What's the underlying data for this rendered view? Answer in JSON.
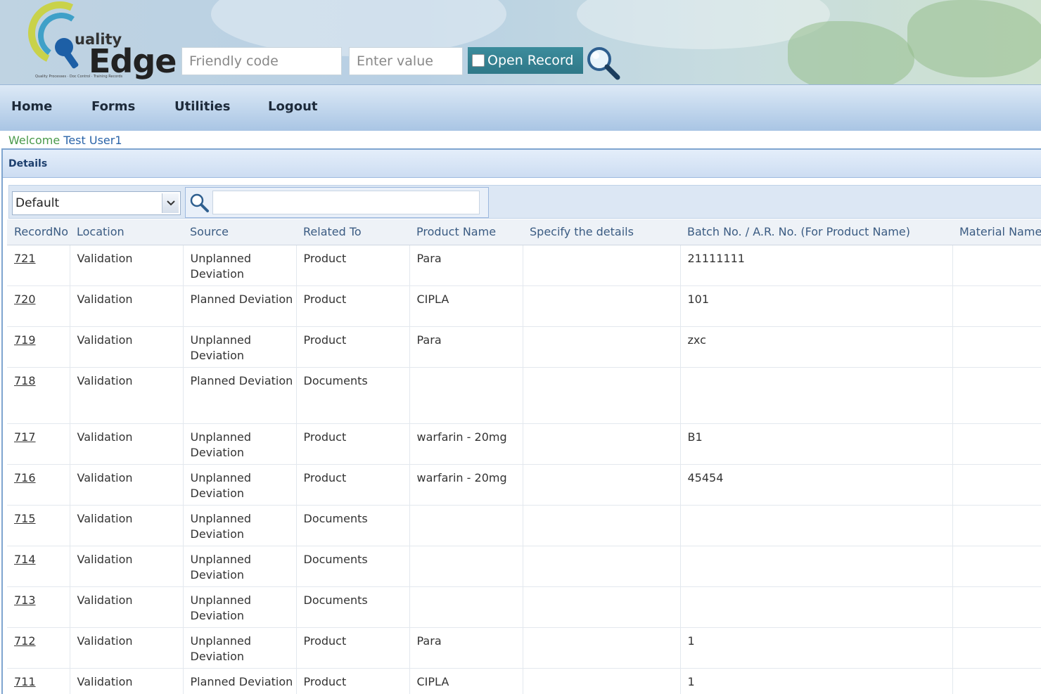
{
  "header": {
    "logo": {
      "prefix": "uality",
      "name": "Edge",
      "tagline": "Quality Processes · Doc Control · Training Records"
    },
    "friendly_code_placeholder": "Friendly code",
    "value_placeholder": "Enter value",
    "open_record_label": "Open Record"
  },
  "nav": {
    "items": [
      {
        "label": "Home"
      },
      {
        "label": "Forms"
      },
      {
        "label": "Utilities"
      },
      {
        "label": "Logout"
      }
    ]
  },
  "welcome": {
    "prefix": "Welcome",
    "user": "Test User1"
  },
  "panel": {
    "title": "Details"
  },
  "toolbar": {
    "view_selected": "Default",
    "search_value": ""
  },
  "table": {
    "columns": [
      "RecordNo",
      "Location",
      "Source",
      "Related To",
      "Product Name",
      "Specify the details",
      "Batch No. / A.R. No. (For Product Name)",
      "Material Name"
    ],
    "rows": [
      {
        "record": "721",
        "location": "Validation",
        "source": "Unplanned Deviation",
        "related": "Product",
        "product": "Para",
        "details": "",
        "batch": "21111111",
        "material": ""
      },
      {
        "record": "720",
        "location": "Validation",
        "source": "Planned Deviation",
        "related": "Product",
        "product": "CIPLA",
        "details": "",
        "batch": "101",
        "material": ""
      },
      {
        "record": "719",
        "location": "Validation",
        "source": "Unplanned Deviation",
        "related": "Product",
        "product": "Para",
        "details": "",
        "batch": "zxc",
        "material": ""
      },
      {
        "record": "718",
        "location": "Validation",
        "source": "Planned Deviation",
        "related": "Documents",
        "product": "",
        "details": "",
        "batch": "",
        "material": ""
      },
      {
        "record": "717",
        "location": "Validation",
        "source": "Unplanned Deviation",
        "related": "Product",
        "product": "warfarin - 20mg",
        "details": "",
        "batch": "B1",
        "material": ""
      },
      {
        "record": "716",
        "location": "Validation",
        "source": "Unplanned Deviation",
        "related": "Product",
        "product": "warfarin - 20mg",
        "details": "",
        "batch": "45454",
        "material": ""
      },
      {
        "record": "715",
        "location": "Validation",
        "source": "Unplanned Deviation",
        "related": "Documents",
        "product": "",
        "details": "",
        "batch": "",
        "material": ""
      },
      {
        "record": "714",
        "location": "Validation",
        "source": "Unplanned Deviation",
        "related": "Documents",
        "product": "",
        "details": "",
        "batch": "",
        "material": ""
      },
      {
        "record": "713",
        "location": "Validation",
        "source": "Unplanned Deviation",
        "related": "Documents",
        "product": "",
        "details": "",
        "batch": "",
        "material": ""
      },
      {
        "record": "712",
        "location": "Validation",
        "source": "Unplanned Deviation",
        "related": "Product",
        "product": "Para",
        "details": "",
        "batch": "1",
        "material": ""
      },
      {
        "record": "711",
        "location": "Validation",
        "source": "Planned Deviation",
        "related": "Product",
        "product": "CIPLA",
        "details": "",
        "batch": "1",
        "material": ""
      }
    ]
  },
  "colors": {
    "nav_text": "#1d2a3a",
    "header_text": "#3a5b82",
    "welcome_green": "#4a9a4a",
    "welcome_blue": "#2b64a8",
    "button": "#2f7888"
  }
}
